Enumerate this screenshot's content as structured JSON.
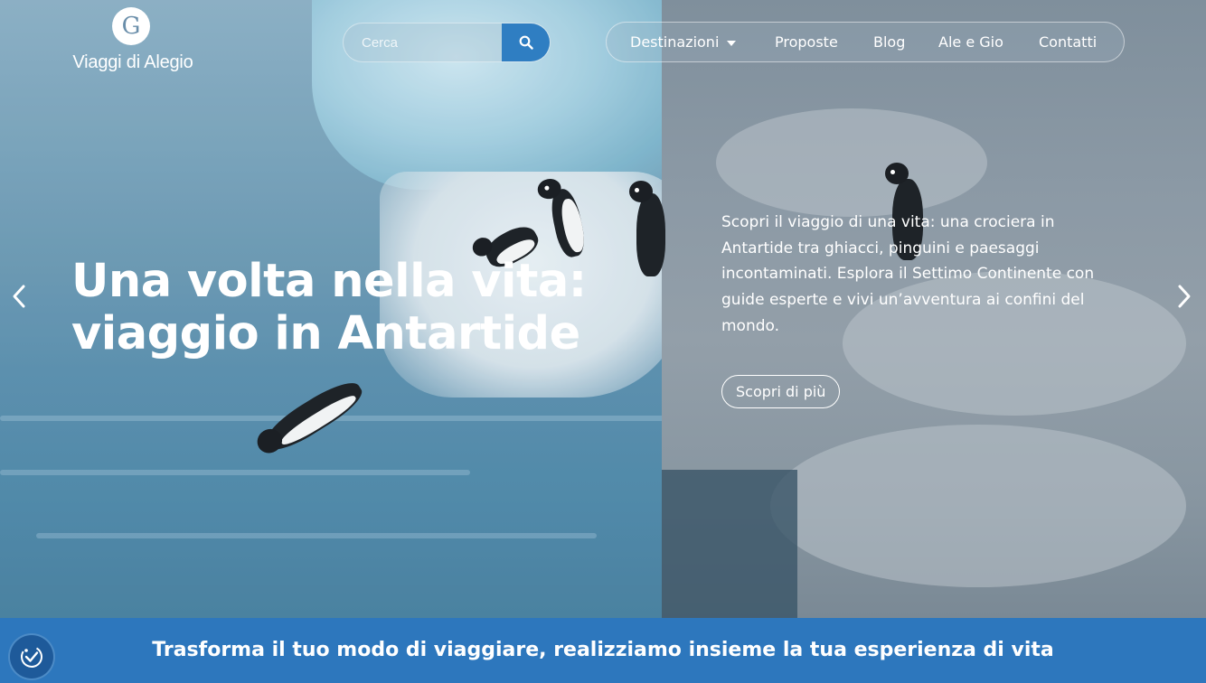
{
  "brand": {
    "logo_text": "Viaggi di Alegio",
    "logo_glyph": "G",
    "logo_icon": "alegio-logo-icon"
  },
  "search": {
    "placeholder": "Cerca",
    "button_icon": "search-icon"
  },
  "nav": {
    "items": [
      {
        "label": "Destinazioni",
        "has_dropdown": true
      },
      {
        "label": "Proposte"
      },
      {
        "label": "Blog"
      },
      {
        "label": "Ale e Gio"
      },
      {
        "label": "Contatti"
      }
    ]
  },
  "hero": {
    "title_line1": "Una volta nella vita:",
    "title_line2": "viaggio in Antartide",
    "description": "Scopri il viaggio di una vita: una crociera in Antartide tra ghiacci, pinguini e paesaggi incontaminati. Esplora il Settimo Continente con guide esperte e vivi un’avventura ai confini del mondo.",
    "cta_label": "Scopri di più",
    "prev_icon": "chevron-left-icon",
    "next_icon": "chevron-right-icon"
  },
  "banner": {
    "text": "Trasforma il tuo modo di viaggiare, realizziamo insieme la tua esperienza di vita"
  },
  "accessibility": {
    "icon": "accessibility-icon"
  },
  "colors": {
    "accent": "#2d77bd",
    "search_button": "#2f7ec2",
    "text": "#ffffff"
  }
}
